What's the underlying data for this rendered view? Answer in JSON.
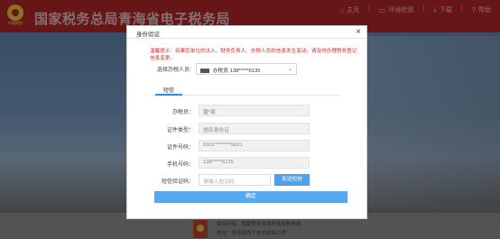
{
  "site": {
    "logo_band_text": "中国税务",
    "title": "国家税务总局青海省电子税务局",
    "nav": [
      {
        "icon": "home-icon",
        "glyph": "⌂",
        "label": "主页"
      },
      {
        "icon": "monitor-icon",
        "glyph": "▭",
        "label": "环境检测"
      },
      {
        "icon": "download-icon",
        "glyph": "⤓",
        "label": "下载"
      },
      {
        "icon": "help-icon",
        "glyph": "?",
        "label": "帮助"
      }
    ],
    "footer": {
      "line1": "版权所有：国家税务总局青海省税务局",
      "line2": "地址：青海省西宁市文化街11号"
    }
  },
  "dialog": {
    "title": "身份验证",
    "close_glyph": "×",
    "warning": "温馨提示：如果您单位的法人、财务负责人、办税人员的信息发生变动，请及时办理税务登记信息变更。",
    "taxpayer_label": "选择办税人员:",
    "taxpayer_value": "办税员 138*****6135",
    "tab_label": "短信",
    "fields": [
      {
        "label": "办税员：",
        "value": "雷*翡"
      },
      {
        "label": "证件类型：",
        "value": "居民身份证"
      },
      {
        "label": "证件号码：",
        "value": "6301********5621"
      },
      {
        "label": "手机号码：",
        "value": "138*****6135"
      }
    ],
    "code_label": "短信验证码：",
    "code_placeholder": "请输入验证码",
    "send_button": "发送短信",
    "confirm_button": "确定"
  },
  "colors": {
    "header_red": "#a52526",
    "accent_blue": "#4ea0e8",
    "warning_red": "#d42a2a"
  }
}
